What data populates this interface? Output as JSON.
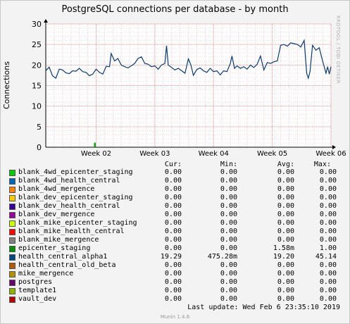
{
  "chart_data": {
    "type": "line",
    "title": "PostgreSQL connections per database - by month",
    "ylabel": "Connections",
    "xlabel": "",
    "ylim": [
      0,
      30
    ],
    "yticks": [
      0,
      5,
      10,
      15,
      20,
      25,
      30
    ],
    "xlim_days": [
      0,
      34
    ],
    "x_ticks": [
      {
        "label": "Week 02",
        "day": 6
      },
      {
        "label": "Week 03",
        "day": 13
      },
      {
        "label": "Week 04",
        "day": 20
      },
      {
        "label": "Week 05",
        "day": 27
      },
      {
        "label": "Week 06",
        "day": 34
      }
    ],
    "grid": true,
    "series": [
      {
        "name": "health_central_alpha1",
        "color": "#0a3a6e",
        "points": [
          [
            0.0,
            18.6
          ],
          [
            0.4,
            19.5
          ],
          [
            0.8,
            17.4
          ],
          [
            1.2,
            16.8
          ],
          [
            1.6,
            19.0
          ],
          [
            2.0,
            18.8
          ],
          [
            2.4,
            18.1
          ],
          [
            2.8,
            17.9
          ],
          [
            3.2,
            18.6
          ],
          [
            3.6,
            18.5
          ],
          [
            4.0,
            19.2
          ],
          [
            4.4,
            18.4
          ],
          [
            4.8,
            18.2
          ],
          [
            5.2,
            17.4
          ],
          [
            5.6,
            17.8
          ],
          [
            6.0,
            19.0
          ],
          [
            6.4,
            18.2
          ],
          [
            6.8,
            17.8
          ],
          [
            7.2,
            19.7
          ],
          [
            7.6,
            19.6
          ],
          [
            7.8,
            22.8
          ],
          [
            8.2,
            21.0
          ],
          [
            8.6,
            21.6
          ],
          [
            9.0,
            20.0
          ],
          [
            9.4,
            19.6
          ],
          [
            9.8,
            19.3
          ],
          [
            10.2,
            19.8
          ],
          [
            10.6,
            20.4
          ],
          [
            11.0,
            21.6
          ],
          [
            11.4,
            22.0
          ],
          [
            11.8,
            20.4
          ],
          [
            12.2,
            20.2
          ],
          [
            12.6,
            19.6
          ],
          [
            13.0,
            19.8
          ],
          [
            13.4,
            19.0
          ],
          [
            13.8,
            20.0
          ],
          [
            14.2,
            20.4
          ],
          [
            14.4,
            24.7
          ],
          [
            14.6,
            20.0
          ],
          [
            15.0,
            19.4
          ],
          [
            15.4,
            18.8
          ],
          [
            15.8,
            19.2
          ],
          [
            16.2,
            18.6
          ],
          [
            16.6,
            18.0
          ],
          [
            17.0,
            21.5
          ],
          [
            17.3,
            20.0
          ],
          [
            17.6,
            17.5
          ],
          [
            18.0,
            18.9
          ],
          [
            18.4,
            19.3
          ],
          [
            18.8,
            18.6
          ],
          [
            19.2,
            18.2
          ],
          [
            19.6,
            19.2
          ],
          [
            20.0,
            18.4
          ],
          [
            20.4,
            18.6
          ],
          [
            20.8,
            17.6
          ],
          [
            21.2,
            18.6
          ],
          [
            21.6,
            18.4
          ],
          [
            22.0,
            20.4
          ],
          [
            22.2,
            22.2
          ],
          [
            22.5,
            19.2
          ],
          [
            22.8,
            19.8
          ],
          [
            23.2,
            19.2
          ],
          [
            23.6,
            19.6
          ],
          [
            24.0,
            19.0
          ],
          [
            24.4,
            20.0
          ],
          [
            24.8,
            19.4
          ],
          [
            25.2,
            20.2
          ],
          [
            25.6,
            22.2
          ],
          [
            26.0,
            18.8
          ],
          [
            26.4,
            20.6
          ],
          [
            26.8,
            20.4
          ],
          [
            27.2,
            20.8
          ],
          [
            27.6,
            21.0
          ],
          [
            28.0,
            24.8
          ],
          [
            28.4,
            25.0
          ],
          [
            28.8,
            24.6
          ],
          [
            29.2,
            25.4
          ],
          [
            29.6,
            25.2
          ],
          [
            30.0,
            25.0
          ],
          [
            30.4,
            24.4
          ],
          [
            30.8,
            26.0
          ],
          [
            31.1,
            18.0
          ],
          [
            31.3,
            16.8
          ],
          [
            31.5,
            18.4
          ],
          [
            31.8,
            24.8
          ],
          [
            32.2,
            23.6
          ],
          [
            32.6,
            24.2
          ],
          [
            33.0,
            21.0
          ],
          [
            33.4,
            18.0
          ],
          [
            33.6,
            19.6
          ],
          [
            33.8,
            17.8
          ],
          [
            34.0,
            19.6
          ]
        ]
      },
      {
        "name": "epicenter_staging",
        "color": "#00a000",
        "points": [
          [
            5.8,
            0.0
          ],
          [
            5.8,
            1.0
          ],
          [
            5.9,
            1.0
          ],
          [
            5.9,
            0.0
          ]
        ]
      }
    ]
  },
  "watermark": "RRDTOOL / TOBI OETIKER",
  "legend": {
    "headers": [
      "Cur:",
      "Min:",
      "Avg:",
      "Max:"
    ],
    "rows": [
      {
        "name": "blank_4wd_epicenter_staging",
        "color": "#00cc00",
        "cur": "0.00",
        "min": "0.00",
        "avg": "0.00",
        "max": "0.00"
      },
      {
        "name": "blank_4wd_health_central",
        "color": "#0066b3",
        "cur": "0.00",
        "min": "0.00",
        "avg": "0.00",
        "max": "0.00"
      },
      {
        "name": "blank_4wd_mergence",
        "color": "#ff8000",
        "cur": "0.00",
        "min": "0.00",
        "avg": "0.00",
        "max": "0.00"
      },
      {
        "name": "blank_dev_epicenter_staging",
        "color": "#ffcc00",
        "cur": "0.00",
        "min": "0.00",
        "avg": "0.00",
        "max": "0.00"
      },
      {
        "name": "blank_dev_health_central",
        "color": "#330099",
        "cur": "0.00",
        "min": "0.00",
        "avg": "0.00",
        "max": "0.00"
      },
      {
        "name": "blank_dev_mergence",
        "color": "#990099",
        "cur": "0.00",
        "min": "0.00",
        "avg": "0.00",
        "max": "0.00"
      },
      {
        "name": "blank_mike_epicenter_staging",
        "color": "#ccff00",
        "cur": "0.00",
        "min": "0.00",
        "avg": "0.00",
        "max": "0.00"
      },
      {
        "name": "blank_mike_health_central",
        "color": "#ff0000",
        "cur": "0.00",
        "min": "0.00",
        "avg": "0.00",
        "max": "0.00"
      },
      {
        "name": "blank_mike_mergence",
        "color": "#808080",
        "cur": "0.00",
        "min": "0.00",
        "avg": "0.00",
        "max": "0.00"
      },
      {
        "name": "epicenter_staging",
        "color": "#008f00",
        "cur": "0.00",
        "min": "0.00",
        "avg": "1.58m",
        "max": "1.00"
      },
      {
        "name": "health_central_alpha1",
        "color": "#00487d",
        "cur": "19.29",
        "min": "475.28m",
        "avg": "19.20",
        "max": "45.14"
      },
      {
        "name": "health_central_old_beta",
        "color": "#b35a00",
        "cur": "0.00",
        "min": "0.00",
        "avg": "0.00",
        "max": "0.00"
      },
      {
        "name": "mike_mergence",
        "color": "#b38f00",
        "cur": "0.00",
        "min": "0.00",
        "avg": "0.00",
        "max": "0.00"
      },
      {
        "name": "postgres",
        "color": "#6b006b",
        "cur": "0.00",
        "min": "0.00",
        "avg": "0.00",
        "max": "0.00"
      },
      {
        "name": "template1",
        "color": "#8fb300",
        "cur": "0.00",
        "min": "0.00",
        "avg": "0.00",
        "max": "0.00"
      },
      {
        "name": "vault_dev",
        "color": "#b30000",
        "cur": "0.00",
        "min": "0.00",
        "avg": "0.00",
        "max": "0.00"
      }
    ]
  },
  "last_update": "Last update:  Wed Feb  6 23:35:10 2019",
  "footer": "Munin 1.4.6"
}
